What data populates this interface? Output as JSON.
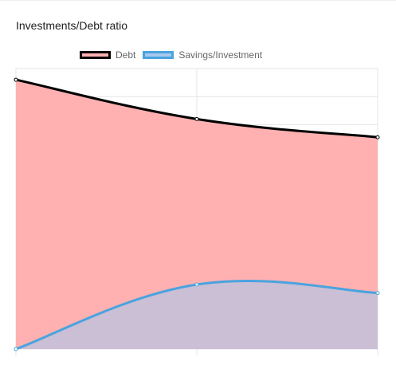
{
  "chart_data": {
    "type": "area",
    "title": "Investments/Debt ratio",
    "legend_position": "top",
    "grid": true,
    "x": [
      0,
      1,
      2
    ],
    "ylim": [
      0,
      100
    ],
    "series": [
      {
        "name": "Debt",
        "values": [
          96,
          82,
          75.5
        ],
        "line_color": "#000000",
        "fill_color": "#ffb1b1"
      },
      {
        "name": "Savings/Investment",
        "values": [
          0,
          23,
          20
        ],
        "line_color": "#4aa3df",
        "fill_color": "#a7c8ec"
      }
    ]
  }
}
